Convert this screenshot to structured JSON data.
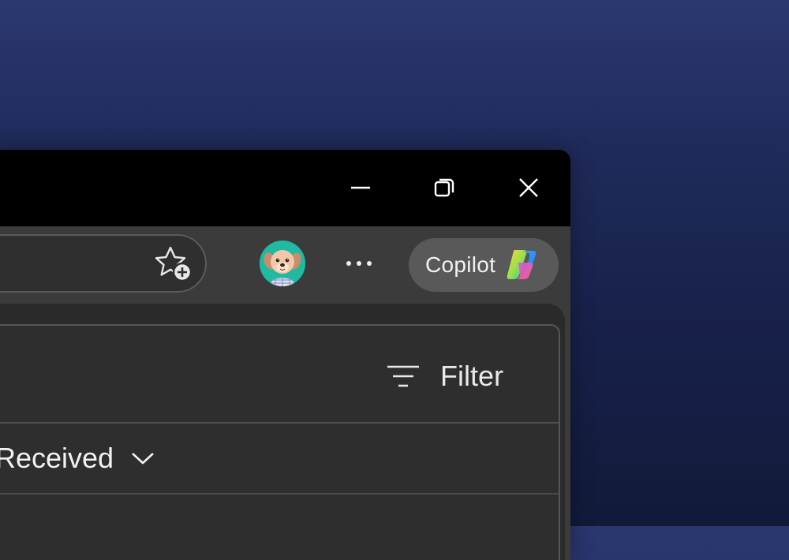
{
  "window": {
    "controls": {
      "minimize": "minimize-icon",
      "restore": "restore-icon",
      "close": "close-icon"
    }
  },
  "toolbar": {
    "favorite_icon": "star-add-icon",
    "more_icon": "more-horizontal-icon",
    "copilot_label": "Copilot",
    "copilot_icon": "copilot-icon"
  },
  "panel": {
    "filter_label": "Filter",
    "filter_icon": "filter-lines-icon",
    "sort_label": "Received",
    "sort_icon": "chevron-down-icon"
  },
  "colors": {
    "background_top": "#2b3770",
    "background_bottom": "#121a3a",
    "titlebar": "#000000",
    "toolbar": "#3b3b3b",
    "copilot_button": "#595959",
    "avatar_bg": "#1fb7a0"
  }
}
